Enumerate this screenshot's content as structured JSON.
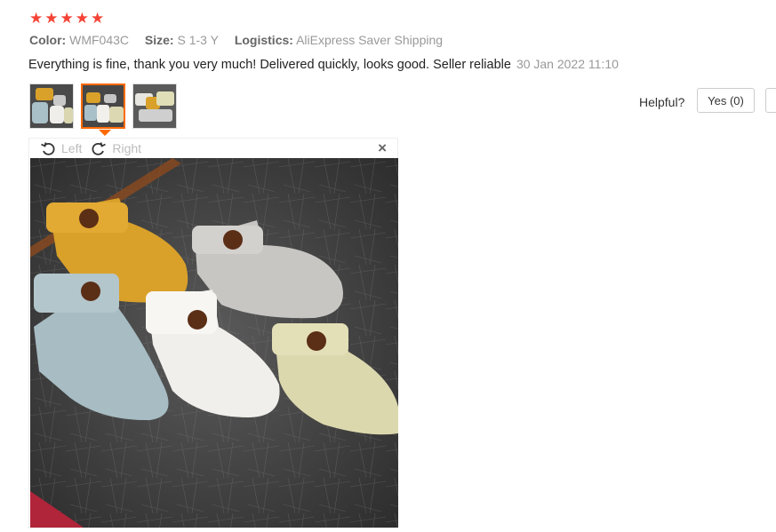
{
  "rating": {
    "stars": 5,
    "star_glyph": "★",
    "color": "#f44336"
  },
  "meta": {
    "color_label": "Color:",
    "color_value": "WMF043C",
    "size_label": "Size:",
    "size_value": "S 1-3 Y",
    "logistics_label": "Logistics:",
    "logistics_value": "AliExpress Saver Shipping"
  },
  "review": {
    "text": "Everything is fine, thank you very much! Delivered quickly, looks good. Seller reliable",
    "date": "30 Jan 2022 11:10"
  },
  "thumbnails": [
    {
      "name": "photo-1",
      "selected": false
    },
    {
      "name": "photo-2",
      "selected": true
    },
    {
      "name": "photo-3",
      "selected": false
    }
  ],
  "helpful": {
    "label": "Helpful?",
    "yes_label": "Yes (0)"
  },
  "viewer": {
    "left_label": "Left",
    "right_label": "Right",
    "close_glyph": "×"
  },
  "colors": {
    "accent": "#ff6a00",
    "muted": "#999999"
  }
}
